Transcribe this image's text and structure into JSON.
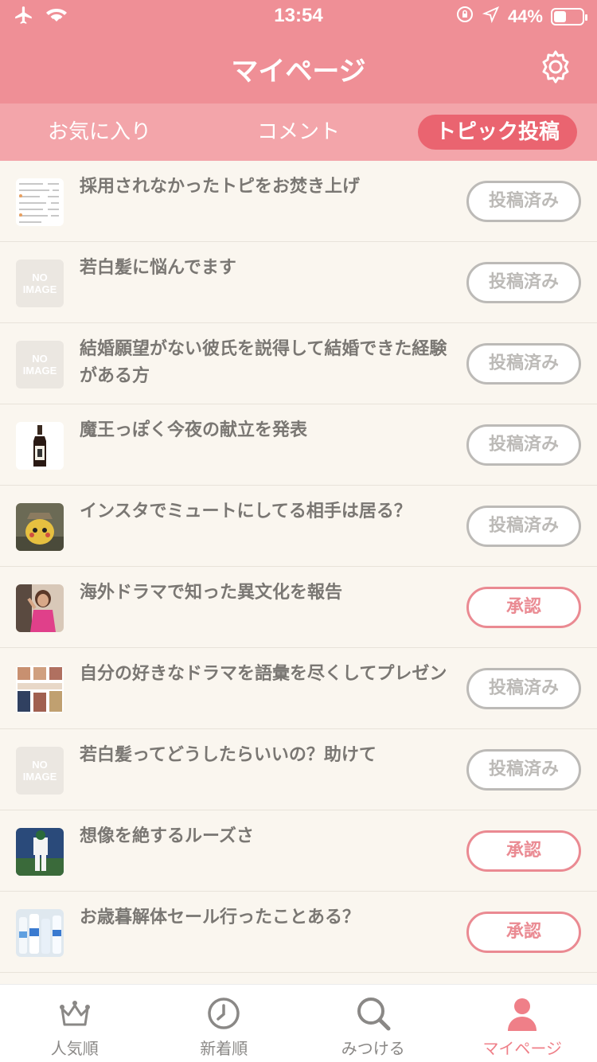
{
  "status_bar": {
    "time": "13:54",
    "battery_text": "44%",
    "battery_level": 0.44,
    "icons": [
      "airplane-icon",
      "wifi-icon",
      "rotation-lock-icon",
      "location-icon",
      "battery-icon"
    ]
  },
  "header": {
    "title": "マイページ",
    "settings_icon": "gear-icon"
  },
  "tabs": [
    {
      "label": "お気に入り",
      "active": false
    },
    {
      "label": "コメント",
      "active": false
    },
    {
      "label": "トピック投稿",
      "active": true
    }
  ],
  "topics": [
    {
      "title": "採用されなかったトピをお焚き上げ",
      "status": "投稿済み",
      "status_type": "posted",
      "thumb": "screenshot"
    },
    {
      "title": "若白髪に悩んでます",
      "status": "投稿済み",
      "status_type": "posted",
      "thumb": "noimage"
    },
    {
      "title": "結婚願望がない彼氏を説得して結婚できた経験がある方",
      "status": "投稿済み",
      "status_type": "posted",
      "thumb": "noimage"
    },
    {
      "title": "魔王っぽく今夜の献立を発表",
      "status": "投稿済み",
      "status_type": "posted",
      "thumb": "bottle"
    },
    {
      "title": "インスタでミュートにしてる相手は居る？",
      "status": "投稿済み",
      "status_type": "posted",
      "thumb": "pikachu"
    },
    {
      "title": "海外ドラマで知った異文化を報告",
      "status": "承認",
      "status_type": "approved",
      "thumb": "drama"
    },
    {
      "title": "自分の好きなドラマを語彙を尽くしてプレゼン",
      "status": "投稿済み",
      "status_type": "posted",
      "thumb": "collage"
    },
    {
      "title": "若白髪ってどうしたらいいの？助けて",
      "status": "投稿済み",
      "status_type": "posted",
      "thumb": "noimage"
    },
    {
      "title": "想像を絶するルーズさ",
      "status": "承認",
      "status_type": "approved",
      "thumb": "baseball"
    },
    {
      "title": "お歳暮解体セール行ったことある？",
      "status": "承認",
      "status_type": "approved",
      "thumb": "bottles"
    }
  ],
  "no_image_text": [
    "NO",
    "IMAGE"
  ],
  "tabbar": [
    {
      "label": "人気順",
      "icon": "crown-icon",
      "active": false
    },
    {
      "label": "新着順",
      "icon": "clock-icon",
      "active": false
    },
    {
      "label": "みつける",
      "icon": "search-icon",
      "active": false
    },
    {
      "label": "マイページ",
      "icon": "person-icon",
      "active": true
    }
  ],
  "colors": {
    "header_pink": "#ef8f96",
    "tab_strip_pink": "#f3a5aa",
    "active_tab": "#ea6470",
    "approved": "#ea8a92",
    "posted": "#bcbab7"
  }
}
